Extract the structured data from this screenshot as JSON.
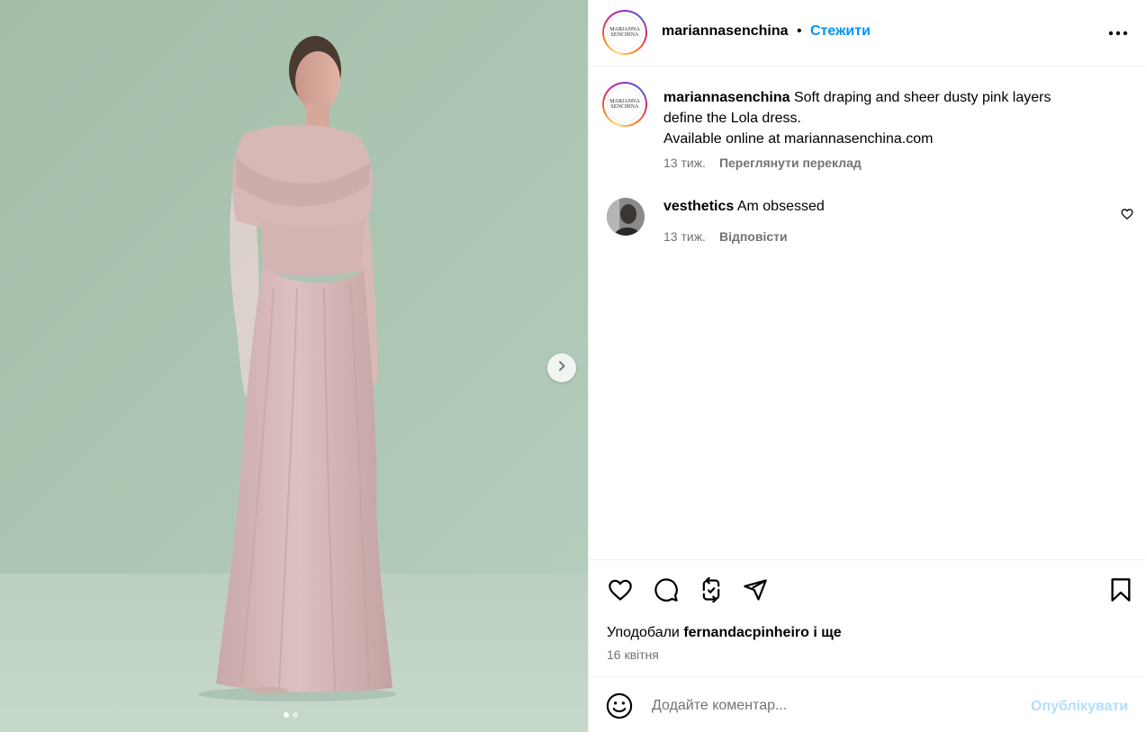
{
  "post": {
    "username": "mariannasenchina",
    "separator": "•",
    "follow_label": "Стежити",
    "avatar_logo_lines": [
      "MARIANNA",
      "SENCHINA"
    ],
    "media": {
      "slide_count": 2,
      "active_slide": 1,
      "next_icon": "chevron-right-icon"
    },
    "caption": {
      "username": "mariannasenchina",
      "text_line1": "Soft draping and sheer dusty pink layers",
      "text_line2": "define the Lola dress.",
      "text_line3": "Available online at mariannasenchina.com",
      "time": "13 тиж.",
      "translate_label": "Переглянути переклад"
    },
    "comments": [
      {
        "username": "vesthetics",
        "text": "Am obsessed",
        "time": "13 тиж.",
        "reply_label": "Відповісти",
        "like_icon": "heart-outline-icon"
      }
    ],
    "actions": {
      "icons": [
        "heart-icon",
        "comment-icon",
        "repost-icon",
        "share-icon",
        "bookmark-icon"
      ]
    },
    "likes": {
      "prefix": "Уподобали",
      "user": "fernandacpinheiro",
      "suffix": "і ще"
    },
    "date": "16 квітня",
    "composer": {
      "placeholder": "Додайте коментар...",
      "post_label": "Опублікувати"
    }
  },
  "colors": {
    "accent": "#0095f6",
    "post_disabled": "#b2dffc",
    "secondary_text": "#737373",
    "background_green": "#a9c3b1",
    "dress_pink": "#d7b9b9"
  }
}
